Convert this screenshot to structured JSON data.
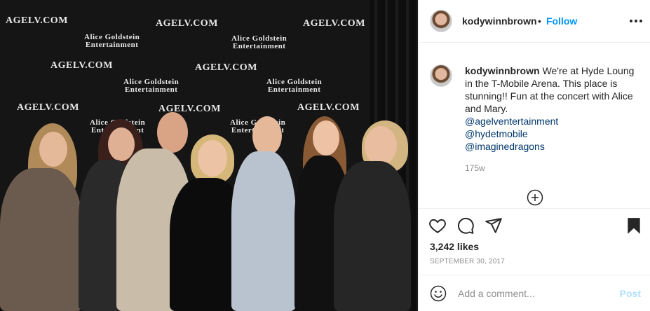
{
  "photo": {
    "backdrop": {
      "logo_main": "AGELV.COM",
      "logo_sub_line1": "Alice Goldstein",
      "logo_sub_line2": "Entertainment"
    }
  },
  "header": {
    "username": "kodywinnbrown",
    "separator": "•",
    "follow_label": "Follow"
  },
  "caption": {
    "username": "kodywinnbrown",
    "text": "We're at Hyde Loung in the T-Mobile Arena. This place is stunning!! Fun at the concert with Alice and Mary.",
    "tags": [
      "@agelventertainment",
      "@hydetmobile",
      "@imaginedragons"
    ],
    "age": "175w"
  },
  "stats": {
    "likes": "3,242 likes",
    "date": "September 30, 2017"
  },
  "comment": {
    "placeholder": "Add a comment...",
    "post_label": "Post"
  },
  "icons": {
    "heart": "heart-icon",
    "comment": "comment-icon",
    "share": "share-icon",
    "save": "bookmark-icon",
    "emoji": "emoji-icon",
    "more": "more-options-icon",
    "load_more": "plus-circle-icon"
  },
  "colors": {
    "accent": "#0095f6",
    "tag": "#00376b",
    "muted": "#8e8e8e",
    "post_disabled": "#b2dffc"
  }
}
